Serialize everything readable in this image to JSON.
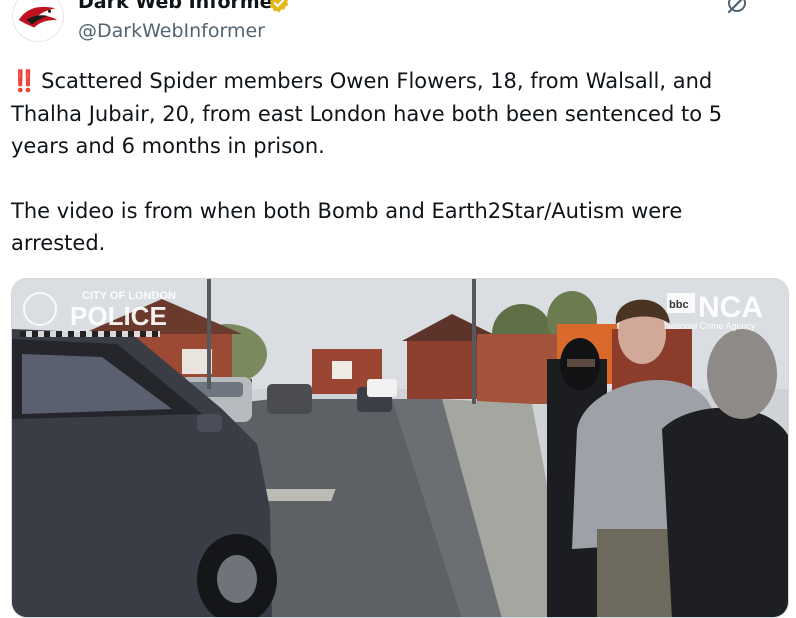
{
  "author": {
    "name": "Dark Web Informer",
    "handle": "@DarkWebInformer",
    "verified": true,
    "avatar_icon": "red-raven-icon"
  },
  "header_icons": [
    "grok-icon",
    "more-options-icon"
  ],
  "more_label": "···",
  "tweet": {
    "emoji": "‼️",
    "paragraph1": "Scattered Spider members Owen Flowers, 18, from Walsall, and Thalha Jubair, 20, from east London have both been sentenced to 5 years and 6 months in prison.",
    "paragraph2": "The video is from when both Bomb and Earth2Star/Autism were arrested."
  },
  "media": {
    "watermark_left_top": "CITY OF LONDON",
    "watermark_left": "POLICE",
    "watermark_right_logo": "bbc",
    "watermark_right": "NCA",
    "watermark_right_sub": "National Crime Agency"
  },
  "colors": {
    "text": "#0f1419",
    "secondary": "#536471",
    "verified_gold": "#e2b719",
    "emoji_red": "#e0245e"
  }
}
